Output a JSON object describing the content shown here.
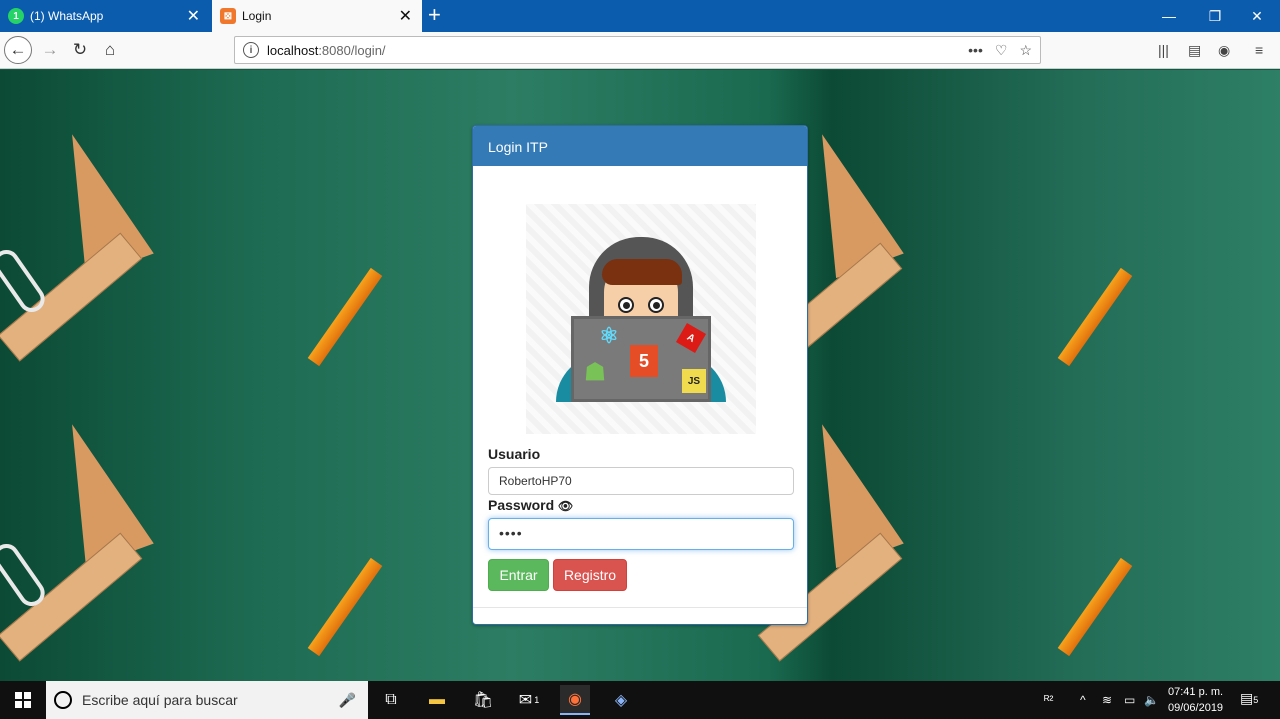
{
  "browser": {
    "tabs": [
      {
        "label": "(1) WhatsApp",
        "badge": "1",
        "active": false
      },
      {
        "label": "Login",
        "active": true
      }
    ],
    "new_tab_icon": "plus-icon",
    "url_host": "localhost",
    "url_rest": ":8080/login/",
    "url_actions": [
      "more-icon",
      "pocket-icon",
      "star-icon"
    ],
    "window_controls": [
      "minimize",
      "maximize",
      "close"
    ]
  },
  "login": {
    "header": "Login ITP",
    "usuario_label": "Usuario",
    "usuario_value": "RobertoHP70",
    "password_label": "Password",
    "password_value": "••••",
    "enter_button": "Entrar",
    "register_button": "Registro",
    "avatar_stickers": {
      "html": "5",
      "js": "JS"
    }
  },
  "taskbar": {
    "search_placeholder": "Escribe aquí para buscar",
    "mail_badge": "1",
    "time": "07:41 p. m.",
    "date": "09/06/2019",
    "notifications": "5"
  },
  "colors": {
    "tab_bar": "#0b5cad",
    "card_header": "#337ab7",
    "enter": "#5cb85c",
    "register": "#d9534f"
  }
}
